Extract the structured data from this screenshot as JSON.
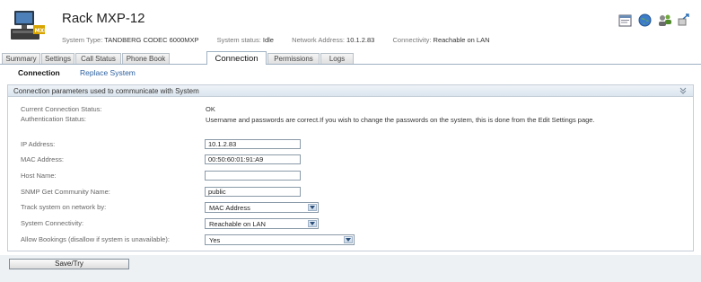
{
  "header": {
    "title": "Rack MXP-12",
    "system_type_label": "System Type:",
    "system_type": "TANDBERG CODEC 6000MXP",
    "status_label": "System status:",
    "status": "Idle",
    "network_address_label": "Network Address:",
    "network_address": "10.1.2.83",
    "connectivity_label": "Connectivity:",
    "connectivity": "Reachable on LAN",
    "icons": [
      "window-icon",
      "globe-icon",
      "users-icon",
      "link-icon"
    ]
  },
  "tabs": [
    {
      "label": "Summary"
    },
    {
      "label": "Settings"
    },
    {
      "label": "Call Status"
    },
    {
      "label": "Phone Book"
    },
    {
      "label": "Connection",
      "active": true
    },
    {
      "label": "Permissions"
    },
    {
      "label": "Logs"
    }
  ],
  "subnav": {
    "active": "Connection",
    "link": "Replace System"
  },
  "panel": {
    "title": "Connection parameters used to communicate with System",
    "current_status_label": "Current Connection Status:",
    "current_status": "OK",
    "auth_label": "Authentication Status:",
    "auth_status": "Username and passwords are correct.If you wish to change the passwords on the system, this is done from the Edit Settings page.",
    "ip_label": "IP Address:",
    "ip_value": "10.1.2.83",
    "mac_label": "MAC Address:",
    "mac_value": "00:50:60:01:91:A9",
    "host_label": "Host Name:",
    "host_value": "",
    "snmp_label": "SNMP Get Community Name:",
    "snmp_value": "public",
    "track_label": "Track system on network by:",
    "track_value": "MAC Address",
    "connectivity_label": "System Connectivity:",
    "connectivity_value": "Reachable on LAN",
    "bookings_label": "Allow Bookings (disallow if system is unavailable):",
    "bookings_value": "Yes"
  },
  "footer": {
    "save_label": "Save/Try"
  },
  "colors": {
    "link": "#2a5fa0",
    "tab_border": "#9fb2c4",
    "panel_header": "#dbe5ee"
  }
}
